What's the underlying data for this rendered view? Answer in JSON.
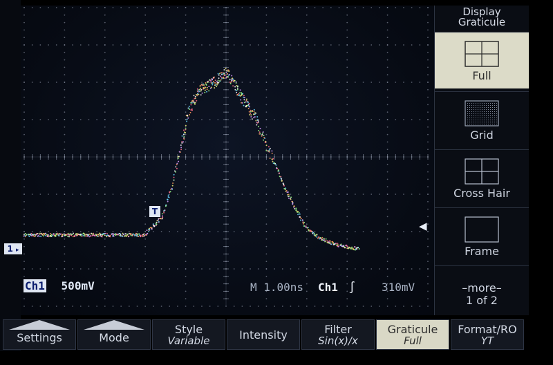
{
  "side_menu": {
    "title_line1": "Display",
    "title_line2": "Graticule",
    "items": [
      {
        "label": "Full",
        "icon": "full-graticule-icon",
        "selected": true
      },
      {
        "label": "Grid",
        "icon": "grid-icon",
        "selected": false
      },
      {
        "label": "Cross Hair",
        "icon": "crosshair-icon",
        "selected": false
      },
      {
        "label": "Frame",
        "icon": "frame-icon",
        "selected": false
      }
    ],
    "more_line1": "–more–",
    "more_line2": "1 of 2"
  },
  "bottom_menu": [
    {
      "line1": "Settings",
      "line2": ""
    },
    {
      "line1": "Mode",
      "line2": ""
    },
    {
      "line1": "Style",
      "line2": "Variable"
    },
    {
      "line1": "Intensity",
      "line2": ""
    },
    {
      "line1": "Filter",
      "line2": "Sin(x)/x"
    },
    {
      "line1": "Graticule",
      "line2": "Full"
    },
    {
      "line1": "Format/RO",
      "line2": "YT"
    }
  ],
  "readouts": {
    "channel_label": "Ch1",
    "volts_per_div": "500mV",
    "timebase": "M 1.00ns",
    "trigger_source": "Ch1",
    "trigger_slope_icon": "rising-edge-icon",
    "trigger_level": "310mV"
  },
  "markers": {
    "trigger_position": "T",
    "channel_ground": "1",
    "trigger_level_arrow": "◀"
  },
  "colors": {
    "screen_background": "#070b14",
    "graticule": "#9aa3b5",
    "readout_text": "#dfe6f2",
    "selected_button": "#d9d8c6"
  }
}
